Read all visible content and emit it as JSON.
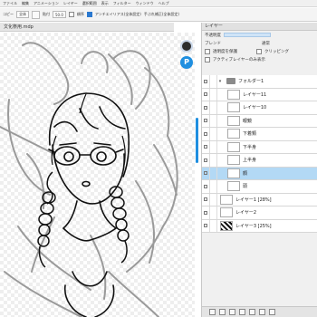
{
  "menu": [
    "ファイル",
    "編集",
    "アニメーション",
    "レイヤー",
    "選択範囲",
    "表示",
    "フィルター",
    "ウィンドウ",
    "ヘルプ"
  ],
  "toolbar": {
    "copy_label": "コピー",
    "source_select": "全体",
    "paste_label": "貼付",
    "size_select": "50.0",
    "order_label": "順序",
    "antialias_label": "アンチエイリアス(全体設定)",
    "stabilize_label": "手ぶれ補正(全体設定)"
  },
  "document": {
    "title": "文化祭用.mdp"
  },
  "layer_panel": {
    "title": "レイヤー",
    "opacity_label": "不透明度",
    "blend_label": "ブレンド",
    "blend_value": "通常",
    "protect_alpha_label": "透明度を保護",
    "clipping_label": "クリッピング",
    "pin_label": "アクティブレイヤーのみ表示",
    "layers": [
      {
        "name": "フォルダー1",
        "type": "folder",
        "selected": false
      },
      {
        "name": "レイヤー11",
        "type": "layer",
        "selected": false
      },
      {
        "name": "レイヤー10",
        "type": "layer",
        "selected": false
      },
      {
        "name": "眼鏡",
        "type": "layer",
        "selected": false
      },
      {
        "name": "下着類",
        "type": "layer",
        "selected": false
      },
      {
        "name": "下半身",
        "type": "layer",
        "selected": false
      },
      {
        "name": "上半身",
        "type": "layer",
        "selected": false
      },
      {
        "name": "顔",
        "type": "layer",
        "selected": true
      },
      {
        "name": "頭",
        "type": "layer",
        "selected": false
      },
      {
        "name": "レイヤー1 [28%]",
        "type": "layer",
        "selected": false
      },
      {
        "name": "レイヤー2",
        "type": "layer",
        "selected": false
      },
      {
        "name": "レイヤー3 [25%]",
        "type": "layer",
        "selected": false
      }
    ]
  }
}
